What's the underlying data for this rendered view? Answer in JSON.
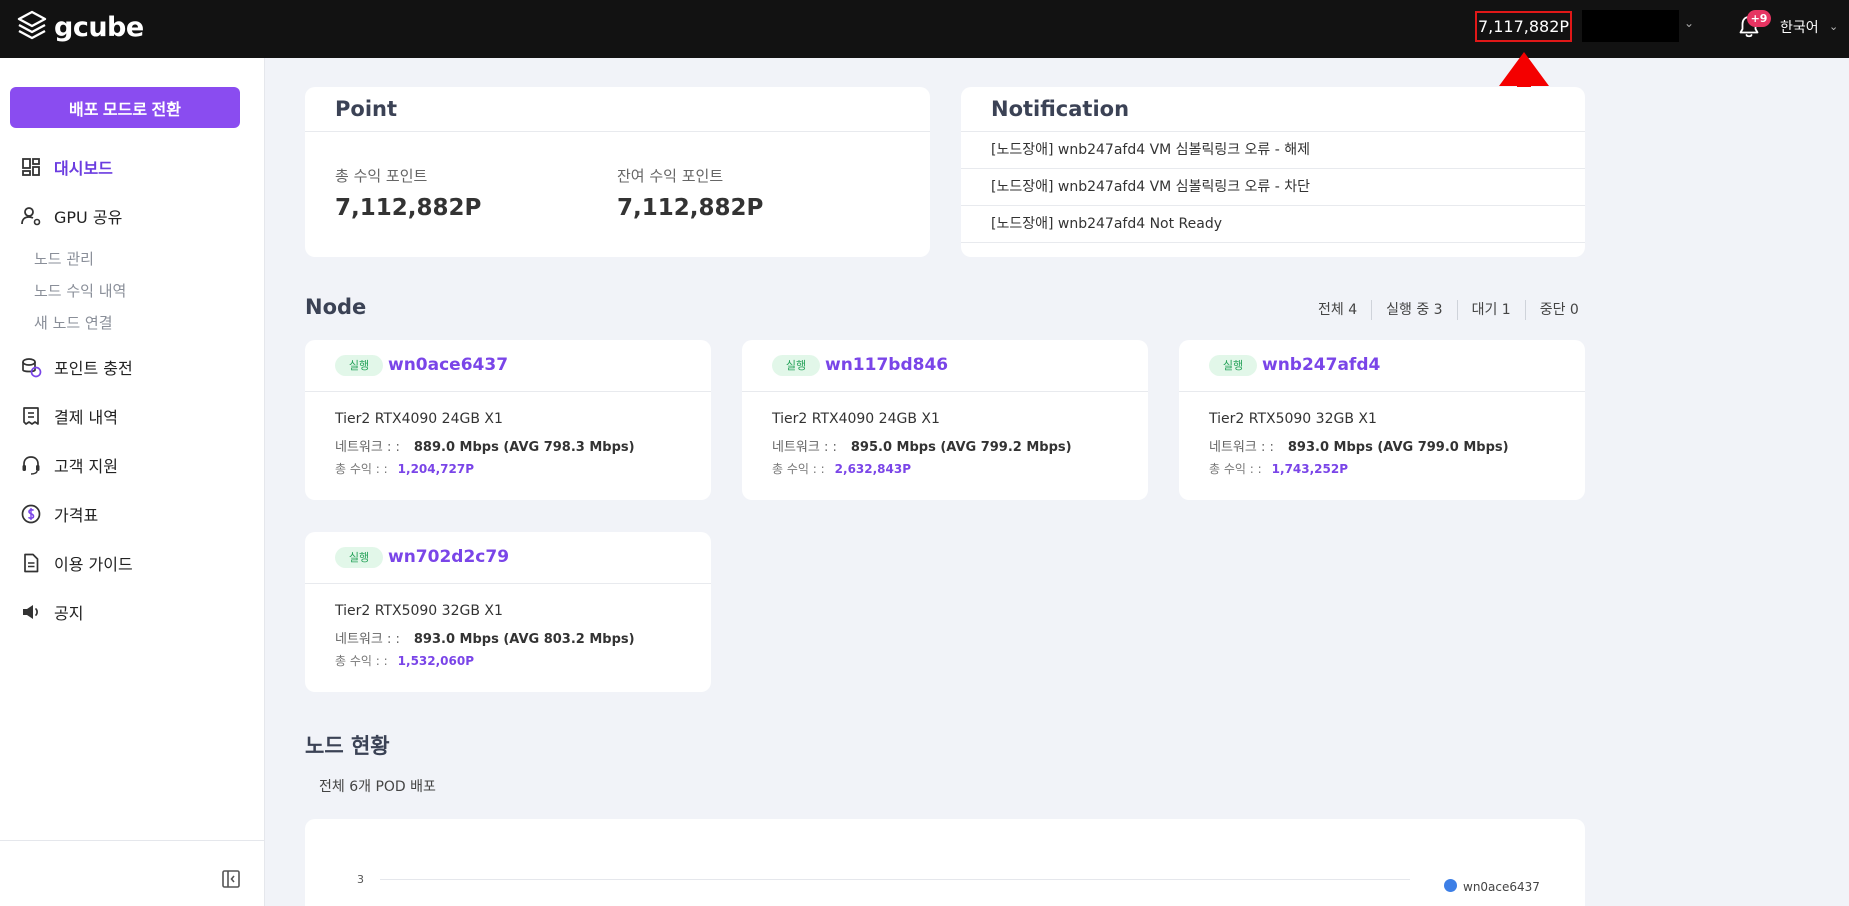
{
  "topbar": {
    "logo_text": "gcube",
    "points": "7,117,882P",
    "notification_count": "+9",
    "language": "한국어"
  },
  "sidebar": {
    "deploy_button": "배포 모드로 전환",
    "items": [
      {
        "label": "대시보드",
        "icon": "dashboard-icon",
        "active": true
      },
      {
        "label": "GPU 공유",
        "icon": "user-gear-icon"
      },
      {
        "label": "포인트 충전",
        "icon": "coins-icon"
      },
      {
        "label": "결제 내역",
        "icon": "receipt-icon"
      },
      {
        "label": "고객 지원",
        "icon": "headset-icon"
      },
      {
        "label": "가격표",
        "icon": "dollar-circle-icon"
      },
      {
        "label": "이용 가이드",
        "icon": "document-icon"
      },
      {
        "label": "공지",
        "icon": "megaphone-icon"
      }
    ],
    "sub_items": [
      "노드 관리",
      "노드 수익 내역",
      "새 노드 연결"
    ]
  },
  "point_card": {
    "title": "Point",
    "total_label": "총 수익 포인트",
    "total_value": "7,112,882P",
    "remaining_label": "잔여 수익 포인트",
    "remaining_value": "7,112,882P"
  },
  "notification_card": {
    "title": "Notification",
    "items": [
      "[노드장애] wnb247afd4 VM 심볼릭링크 오류 - 해제",
      "[노드장애] wnb247afd4 VM 심볼릭링크 오류 - 차단",
      "[노드장애] wnb247afd4 Not Ready"
    ]
  },
  "node_section": {
    "title": "Node",
    "filters": [
      "전체 4",
      "실행 중 3",
      "대기 1",
      "중단 0"
    ],
    "network_label": "네트워크 : :",
    "earnings_label": "총 수익 : :",
    "nodes": [
      {
        "status": "실행",
        "name": "wn0ace6437",
        "spec": "Tier2 RTX4090 24GB X1",
        "network": "889.0 Mbps (AVG 798.3 Mbps)",
        "earnings": "1,204,727P"
      },
      {
        "status": "실행",
        "name": "wn117bd846",
        "spec": "Tier2 RTX4090 24GB X1",
        "network": "895.0 Mbps (AVG 799.2 Mbps)",
        "earnings": "2,632,843P"
      },
      {
        "status": "실행",
        "name": "wnb247afd4",
        "spec": "Tier2 RTX5090 32GB X1",
        "network": "893.0 Mbps (AVG 799.0 Mbps)",
        "earnings": "1,743,252P"
      },
      {
        "status": "실행",
        "name": "wn702d2c79",
        "spec": "Tier2 RTX5090 32GB X1",
        "network": "893.0 Mbps (AVG 803.2 Mbps)",
        "earnings": "1,532,060P"
      }
    ]
  },
  "node_status_section": {
    "title": "노드 현황",
    "summary": "전체 6개 POD 배포",
    "chart_tick": "3",
    "legend": "wn0ace6437",
    "legend_color": "#3d7fe6"
  },
  "colors": {
    "accent": "#8a4cf0",
    "node_name": "#7a45e8",
    "badge_bg": "#e2f7e9",
    "badge_text": "#27a35a",
    "annotation": "#e01818"
  }
}
